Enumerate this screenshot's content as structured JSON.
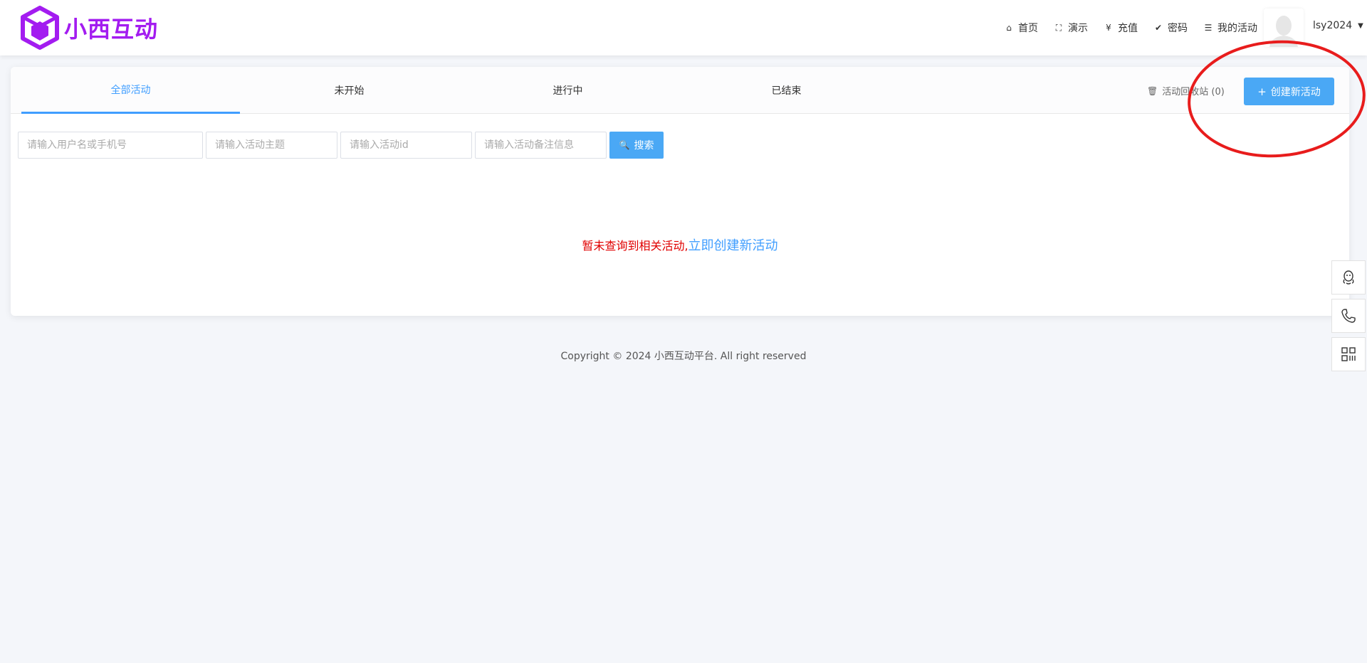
{
  "header": {
    "logo_text": "小西互动",
    "nav": [
      {
        "icon": "home-icon",
        "glyph": "⌂",
        "label": "首页"
      },
      {
        "icon": "expand-icon",
        "glyph": "⛶",
        "label": "演示"
      },
      {
        "icon": "yen-icon",
        "glyph": "¥",
        "label": "充值"
      },
      {
        "icon": "check-circle-icon",
        "glyph": "✔",
        "label": "密码"
      },
      {
        "icon": "list-icon",
        "glyph": "☰",
        "label": "我的活动"
      }
    ],
    "username": "lsy2024"
  },
  "tabs": [
    {
      "label": "全部活动",
      "active": true
    },
    {
      "label": "未开始",
      "active": false
    },
    {
      "label": "进行中",
      "active": false
    },
    {
      "label": "已结束",
      "active": false
    }
  ],
  "toolbar": {
    "recycle_label": "活动回收站 (0)",
    "create_label": "创建新活动"
  },
  "search": {
    "user_placeholder": "请输入用户名或手机号",
    "subject_placeholder": "请输入活动主题",
    "id_placeholder": "请输入活动id",
    "note_placeholder": "请输入活动备注信息",
    "button_label": "搜索"
  },
  "empty": {
    "message": "暂未查询到相关活动,",
    "link": "立即创建新活动"
  },
  "footer": {
    "copyright": "Copyright © 2024 小西互动平台. All right reserved"
  },
  "colors": {
    "brand": "#a31cf0",
    "primary": "#4aa8f5",
    "active_tab": "#409eff",
    "error": "#e00000",
    "annotation": "#e81c1c"
  }
}
